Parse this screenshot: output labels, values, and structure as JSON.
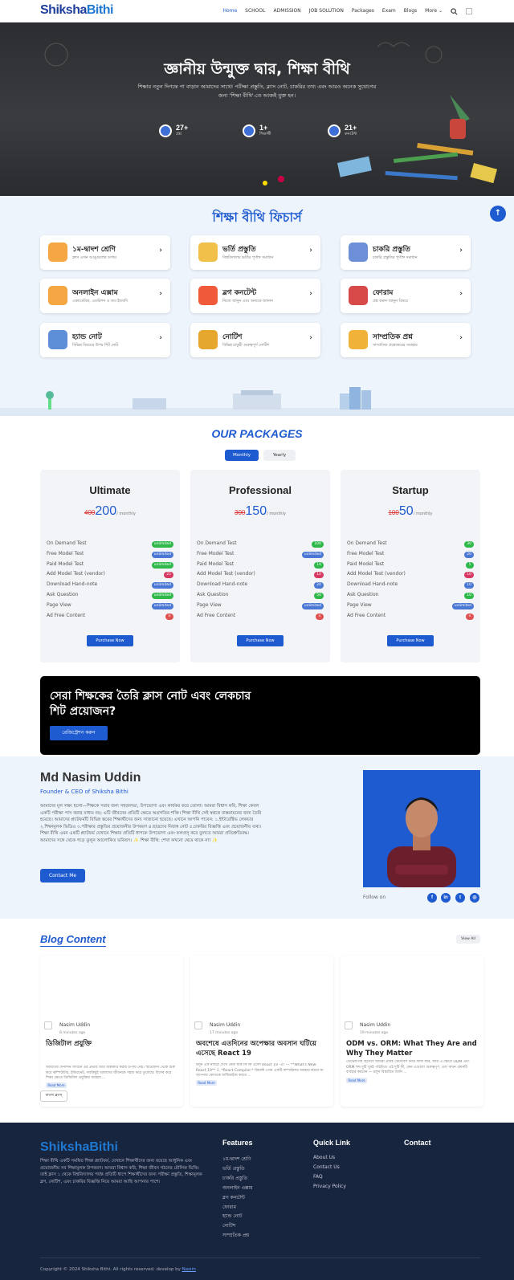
{
  "header": {
    "logo_a": "Shiksha",
    "logo_b": "Bithi",
    "nav": [
      "Home",
      "SCHOOL",
      "ADMISSION",
      "JOB SOLUTION",
      "Packages",
      "Exam",
      "Blogs",
      "More"
    ]
  },
  "hero": {
    "title": "জ্ঞানীয় উন্মুক্ত দ্বার, শিক্ষা বীথি",
    "subtitle": "শিক্ষার নতুন দিগন্তে পা বাড়ান আমাদের সাথে! পরীক্ষা প্রস্তুতি, ক্লাস নোট, চাকরির তথ্য এবং আরও অনেক সুযোগের জন্য 'শিক্ষা বীথি'-তে আজই যুক্ত হন।",
    "stats": [
      {
        "n": "27+",
        "l": "প্রশ্ন"
      },
      {
        "n": "1+",
        "l": "শিক্ষার্থী"
      },
      {
        "n": "21+",
        "l": "কনটেন্ট"
      }
    ]
  },
  "features": {
    "title": "শিক্ষা বীথি ফিচার্স",
    "items": [
      {
        "t": "১ম-দ্বাদশ শ্রেণি",
        "s": "ক্লাস এখন আঙ্গুলের ডগায়"
      },
      {
        "t": "ভর্তি প্রস্তুতি",
        "s": "বিশ্ববিদ্যালয় ভর্তির পূর্ণাঙ্গ সমাধান"
      },
      {
        "t": "চাকরি প্রস্তুতি",
        "s": "চাকরি প্রস্তুতির পূর্ণাঙ্গ সমাধান"
      },
      {
        "t": "অনলাইন এক্সাম",
        "s": "একাডেমিক, এডমিশন ও জব ইত্যাদি"
      },
      {
        "t": "ব্লগ কনটেন্ট",
        "s": "নিজে জানুন এবং অন্যকে জানান"
      },
      {
        "t": "ফোরাম",
        "s": "প্রশ্ন করুন জানুন বিষয়ে"
      },
      {
        "t": "হ্যান্ড নোট",
        "s": "বিভিন্ন বিষয়ের উপর শিট নোট"
      },
      {
        "t": "নোটিশ",
        "s": "বিভিন্ন চাকুরী গুরুত্বপূর্ণ নোটিশ"
      },
      {
        "t": "সাম্প্রতিক প্রশ্ন",
        "s": "সাম্প্রতিক প্রশ্নোত্তরের সমাহার"
      }
    ]
  },
  "packages": {
    "title": "OUR PACKAGES",
    "toggle": [
      "Monthly",
      "Yearly"
    ],
    "per": "/ monthly",
    "button": "Purchase Now",
    "rows": [
      "On Demand Test",
      "Free Model Test",
      "Paid Model Test",
      "Add Model Test (vendor)",
      "Download Hand-note",
      "Ask Question",
      "Page View",
      "Ad Free Content"
    ],
    "plans": [
      {
        "name": "Ultimate",
        "old": "400",
        "new": "200",
        "badges": [
          "unlimited",
          "unlimited",
          "unlimited",
          "25",
          "unlimited",
          "unlimited",
          "unlimited",
          "×"
        ],
        "colors": [
          "#2fb94a",
          "#4a78d4",
          "#2fb94a",
          "#d63a63",
          "#4a78d4",
          "#2fb94a",
          "#4a78d4",
          "#e05252"
        ]
      },
      {
        "name": "Professional",
        "old": "300",
        "new": "150",
        "badges": [
          "100",
          "unlimited",
          "10",
          "10",
          "20",
          "50",
          "unlimited",
          "×"
        ],
        "colors": [
          "#2fb94a",
          "#4a78d4",
          "#2fb94a",
          "#d63a63",
          "#4a78d4",
          "#2fb94a",
          "#4a78d4",
          "#e05252"
        ]
      },
      {
        "name": "Startup",
        "old": "100",
        "new": "50",
        "badges": [
          "30",
          "20",
          "5",
          "10",
          "10",
          "10",
          "unlimited",
          "×"
        ],
        "colors": [
          "#2fb94a",
          "#4a78d4",
          "#2fb94a",
          "#d63a63",
          "#4a78d4",
          "#2fb94a",
          "#4a78d4",
          "#e05252"
        ]
      }
    ]
  },
  "cta": {
    "title": "সেরা শিক্ষকের তৈরি ক্লাস নোট এবং লেকচার শিট প্রয়োজন?",
    "button": "রেজিস্ট্রেশন করুন"
  },
  "founder": {
    "name": "Md Nasim Uddin",
    "role": "Founder & CEO of Shiksha Bithi",
    "bio": "আমাদের মূল লক্ষ্য হলো—শিক্ষকে সবার জন্য সহজলভ্য, উপভোগ্য এবং কার্যকর করে তোলা। আমরা বিশ্বাস করি, শিক্ষা কেবল একটি পরীক্ষা পাস করার মাধ্যম নয়; এটি জীবনের প্রতিটি ক্ষেত্রে অগ্রগতির শক্তি। শিক্ষা বীথি সেই স্বপ্নকে বাস্তবায়নের জন্য তৈরি হয়েছে। আমাদের প্ল্যাটফর্মটি বিভিন্ন স্তরের শিক্ষার্থীদের জন্য সাজানো হয়েছে। এখানে আপনি পাবেন: ১.ইন্টারেক্টিভ লেকচার ২.শিক্ষামূলক ভিডিও ৩.পরীক্ষার প্রস্তুতির প্রয়োজনীয় উপকরণ ৪.ছাত্রদের নিজস্ব নোট ৫.চাকরির বিজ্ঞপ্তি এবং প্রয়োজনীয় তথ্য। শিক্ষা বীথি এমন একটি প্ল্যাটফর্ম যেখানে শিক্ষার প্রতিটি ধাপকে উপভোগ্য এবং ফলপ্রসূ করে তুলতে আমরা প্রতিশ্রুতিবদ্ধ। আমাদের সঙ্গে থেকে গড়ে তুলুন আলোকিত ভবিষ্যৎ। ✨ শিক্ষা বীথি: শেখা কখনো থেমে থাকে না! ✨",
    "button": "Contact Me",
    "follow": "Follow on"
  },
  "blog": {
    "title": "Blog Content",
    "view_all": "View All",
    "more": "Read More",
    "lang": "বাংলা ব্লগস্",
    "posts": [
      {
        "author": "Nasim Uddin",
        "time": "8 minutes ago",
        "title": "ডিজিটাল প্রযুক্তি",
        "excerpt": "আমাদের দৈনন্দিন জীবনে এর প্রভাব আর অস্বীকার করার উপায় নেই। স্মার্টফোন থেকে শুরু করে কম্পিউটার, ইন্টারনেট, সবকিছুই আমাদের জীবনকে সহজ করে তুলেছে। বিশেষ করে শিক্ষা ক্ষেত্রে ডিজিটাল প্রযুক্তির ব্যবহার ..."
      },
      {
        "author": "Nasim Uddin",
        "time": "17 minutes ago",
        "title": "অবশেষে এতদিনের অপেক্ষার অবসান ঘটিয়ে এসেছে React 19",
        "excerpt": "চলুন এক নজরে দেখে নেয়া যাক কি কি এলো React 19 -এ! --- **What's New: React 19** 1. *React Compiler:* রিয়্যাক্ট এখন একটি কম্পাইলার ব্যবহার করবে যা আপনার কোডকে অপ্টিমাইজ করবে ..."
      },
      {
        "author": "Nasim Uddin",
        "time": "19 minutes ago",
        "title": "ODM vs. ORM: What They Are and Why They Matter",
        "excerpt": "ডেভেলপার হিসেবে আমরা প্রায়ই ডেটাবেস নিয়ে কাজ করি, আর এ ক্ষেত্রে ODM এবং ORM শব্দ দুটি খুবই পরিচিত। এই দুটি কী, কেন এগুলো গুরুত্বপূর্ণ, এবং কখন কোনটি ব্যবহার করবেন — চলুন বিস্তারিত জানি ..."
      }
    ]
  },
  "footer": {
    "logo": "ShikshaBithi",
    "desc": "শিক্ষা বীথি একটি সমন্বিত শিক্ষা প্ল্যাটফর্ম, যেখানে শিক্ষার্থীদের জন্য রয়েছে আধুনিক এবং প্রয়োজনীয় সব শিক্ষামূলক উপকরণ। আমরা বিশ্বাস করি, শিক্ষা জীবন গঠনের মৌলিক ভিত্তি। তাই ক্লাস ১ থেকে বিশ্ববিদ্যালয় পর্যন্ত প্রতিটি ধাপে শিক্ষার্থীদের জন্য পরীক্ষা প্রস্তুতি, শিক্ষামূলক ব্লগ, নোটিশ, এবং চাকরির বিজ্ঞপ্তি নিয়ে আমরা আছি আপনার পাশে।",
    "features_h": "Features",
    "features": [
      "১ম-দ্বাদশ শ্রেণি",
      "ভর্তি প্রস্তুতি",
      "চাকরি প্রস্তুতি",
      "অনলাইন এক্সাম",
      "ব্লগ কনটেন্ট",
      "ফোরাম",
      "হ্যান্ড নোট",
      "নোটিশ",
      "সাম্প্রতিক প্রশ্ন"
    ],
    "quick_h": "Quick Link",
    "quick": [
      "About Us",
      "Contact Us",
      "FAQ",
      "Privacy Policy"
    ],
    "contact_h": "Contact",
    "copyright": "Copyright © 2024 Shiksha Bithi. All rights reserved. develop by ",
    "dev": "Nasim"
  }
}
